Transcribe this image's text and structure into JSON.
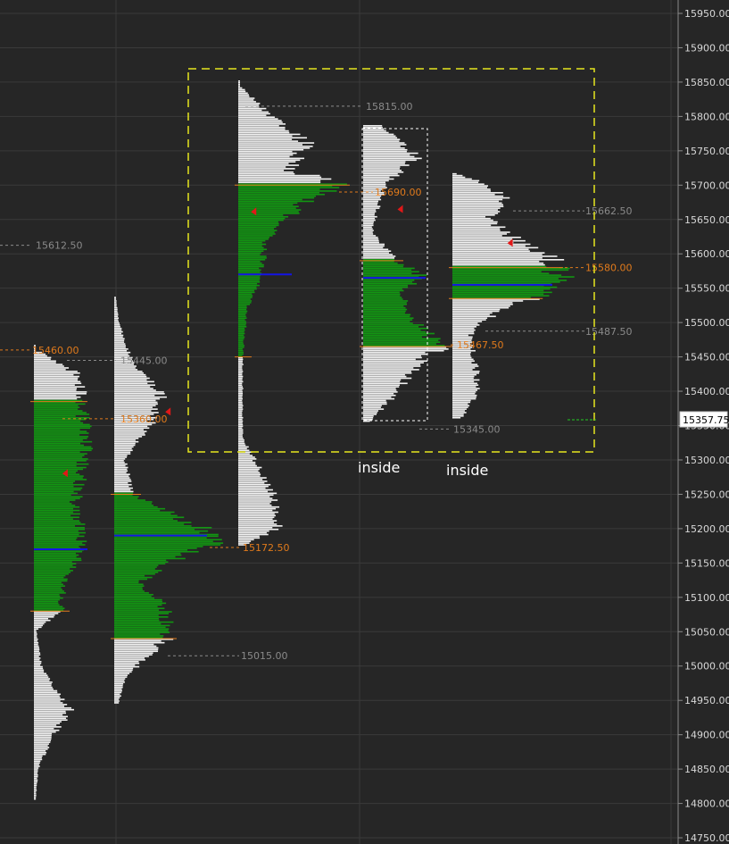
{
  "chart_data": {
    "type": "market-profile",
    "y_axis": {
      "min": 14750,
      "max": 15950,
      "ticks": [
        15950,
        15900,
        15850,
        15800,
        15750,
        15700,
        15650,
        15600,
        15550,
        15500,
        15450,
        15400,
        15350,
        15300,
        15250,
        15200,
        15150,
        15100,
        15050,
        15000,
        14950,
        14900,
        14850,
        14800,
        14750
      ],
      "tick_labels": [
        "15950.00",
        "15900.00",
        "15850.00",
        "15800.00",
        "15750.00",
        "15700.00",
        "15650.00",
        "15600.00",
        "15550.00",
        "15500.00",
        "15450.00",
        "15400.00",
        "15350.00",
        "15300.00",
        "15250.00",
        "15200.00",
        "15150.00",
        "15100.00",
        "15050.00",
        "15000.00",
        "14950.00",
        "14900.00",
        "14850.00",
        "14800.00",
        "14750.00"
      ],
      "current_price": 15357.75,
      "current_price_label": "15357.75",
      "position": "right"
    },
    "colors": {
      "background": "#262626",
      "grid": "#3a3a3a",
      "profile_green": "#129612",
      "profile_white": "#f2f2f2",
      "poc": "#1414e6",
      "value_line": "#e07a1c",
      "level_gray": "#8a8a8a",
      "level_orange": "#e07a1c",
      "highlight_box": "#e6e61e",
      "inside_box": "#ffffff",
      "last_price_line": "#22cc22"
    },
    "level_labels": [
      {
        "text": "15612.50",
        "price": 15612.5,
        "color": "gray"
      },
      {
        "text": "15460.00",
        "price": 15460,
        "color": "orange"
      },
      {
        "text": "15445.00",
        "price": 15445,
        "color": "gray"
      },
      {
        "text": "15360.00",
        "price": 15360,
        "color": "orange"
      },
      {
        "text": "15815.00",
        "price": 15815,
        "color": "gray"
      },
      {
        "text": "15690.00",
        "price": 15690,
        "color": "orange"
      },
      {
        "text": "15172.50",
        "price": 15172.5,
        "color": "orange"
      },
      {
        "text": "15015.00",
        "price": 15015,
        "color": "gray"
      },
      {
        "text": "15662.50",
        "price": 15662.5,
        "color": "gray"
      },
      {
        "text": "15580.00",
        "price": 15580,
        "color": "orange"
      },
      {
        "text": "15487.50",
        "price": 15487.5,
        "color": "gray"
      },
      {
        "text": "15467.50",
        "price": 15467.5,
        "color": "orange"
      },
      {
        "text": "15345.00",
        "price": 15345,
        "color": "gray"
      }
    ],
    "profiles": [
      {
        "name": "profile-1",
        "low": 14805,
        "high": 15465,
        "poc": 15170,
        "vah": 15385,
        "val": 15080,
        "shape": [
          [
            14805,
            2
          ],
          [
            14850,
            5
          ],
          [
            14900,
            22
          ],
          [
            14935,
            42
          ],
          [
            14960,
            25
          ],
          [
            15000,
            8
          ],
          [
            15050,
            3
          ],
          [
            15080,
            30
          ],
          [
            15120,
            35
          ],
          [
            15170,
            58
          ],
          [
            15230,
            45
          ],
          [
            15290,
            55
          ],
          [
            15340,
            60
          ],
          [
            15385,
            50
          ],
          [
            15420,
            55
          ],
          [
            15455,
            8
          ]
        ]
      },
      {
        "name": "profile-2",
        "low": 14945,
        "high": 15535,
        "poc": 15190,
        "vah": 15250,
        "val": 15040,
        "shape": [
          [
            14945,
            5
          ],
          [
            14980,
            12
          ],
          [
            15010,
            35
          ],
          [
            15040,
            60
          ],
          [
            15080,
            58
          ],
          [
            15120,
            30
          ],
          [
            15150,
            60
          ],
          [
            15175,
            110
          ],
          [
            15200,
            100
          ],
          [
            15225,
            55
          ],
          [
            15250,
            20
          ],
          [
            15300,
            12
          ],
          [
            15350,
            40
          ],
          [
            15390,
            55
          ],
          [
            15440,
            20
          ],
          [
            15500,
            5
          ],
          [
            15535,
            2
          ]
        ]
      },
      {
        "name": "profile-3",
        "low": 15175,
        "high": 15850,
        "poc": 15570,
        "vah": 15700,
        "val": 15450,
        "shape": [
          [
            15175,
            8
          ],
          [
            15200,
            45
          ],
          [
            15250,
            38
          ],
          [
            15290,
            22
          ],
          [
            15330,
            5
          ],
          [
            15450,
            5
          ],
          [
            15520,
            10
          ],
          [
            15560,
            25
          ],
          [
            15620,
            30
          ],
          [
            15680,
            80
          ],
          [
            15700,
            115
          ],
          [
            15720,
            60
          ],
          [
            15760,
            75
          ],
          [
            15800,
            35
          ],
          [
            15840,
            5
          ]
        ]
      },
      {
        "name": "profile-4",
        "low": 15355,
        "high": 15785,
        "poc": 15565,
        "vah": 15590,
        "val": 15465,
        "shape": [
          [
            15355,
            8
          ],
          [
            15400,
            40
          ],
          [
            15440,
            60
          ],
          [
            15465,
            90
          ],
          [
            15500,
            55
          ],
          [
            15540,
            40
          ],
          [
            15565,
            70
          ],
          [
            15590,
            35
          ],
          [
            15630,
            10
          ],
          [
            15660,
            15
          ],
          [
            15700,
            25
          ],
          [
            15740,
            60
          ],
          [
            15785,
            20
          ]
        ]
      },
      {
        "name": "profile-5",
        "low": 15360,
        "high": 15715,
        "poc": 15555,
        "vah": 15580,
        "val": 15535,
        "shape": [
          [
            15360,
            10
          ],
          [
            15400,
            30
          ],
          [
            15440,
            25
          ],
          [
            15480,
            20
          ],
          [
            15500,
            30
          ],
          [
            15540,
            100
          ],
          [
            15565,
            120
          ],
          [
            15590,
            110
          ],
          [
            15620,
            70
          ],
          [
            15650,
            40
          ],
          [
            15680,
            60
          ],
          [
            15700,
            40
          ],
          [
            15715,
            5
          ]
        ]
      }
    ],
    "annotations": [
      {
        "text": "inside"
      },
      {
        "text": "inside"
      }
    ]
  }
}
